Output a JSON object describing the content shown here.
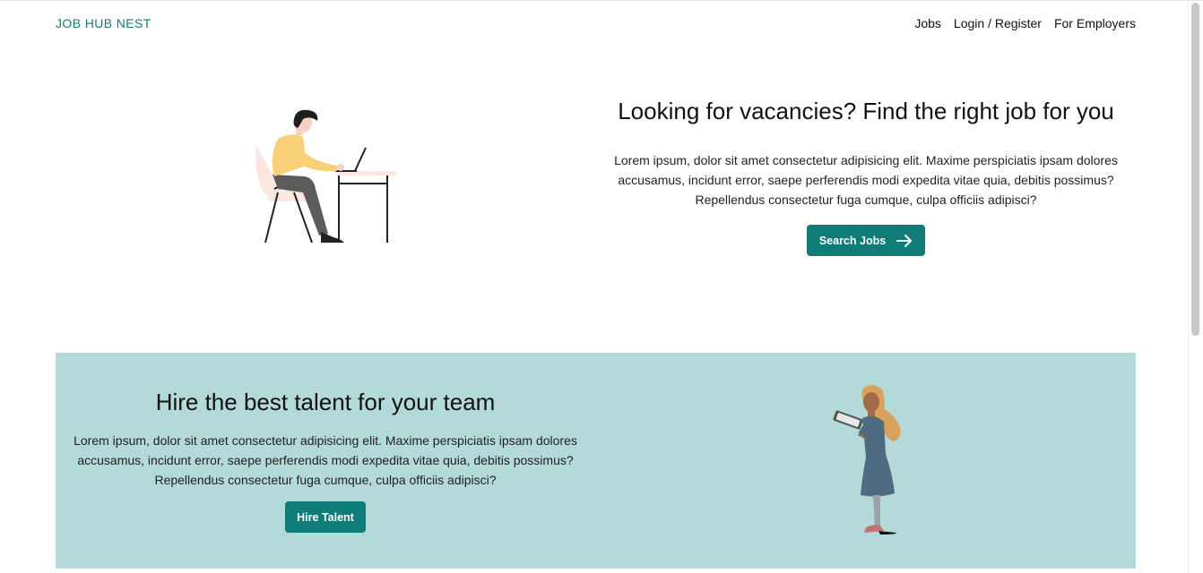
{
  "header": {
    "brand": "JOB HUB NEST",
    "nav": [
      "Jobs",
      "Login / Register",
      "For Employers"
    ]
  },
  "hero": {
    "title": "Looking for vacancies? Find the right job for you",
    "description": "Lorem ipsum, dolor sit amet consectetur adipisicing elit. Maxime perspiciatis ipsam dolores accusamus, incidunt error, saepe perferendis modi expedita vitae quia, debitis possimus? Repellendus consectetur fuga cumque, culpa officiis adipisci?",
    "button_label": "Search Jobs",
    "button_icon": "arrow-right-icon"
  },
  "hire": {
    "title": "Hire the best talent for your team",
    "description": "Lorem ipsum, dolor sit amet consectetur adipisicing elit. Maxime perspiciatis ipsam dolores accusamus, incidunt error, saepe perferendis modi expedita vitae quia, debitis possimus? Repellendus consectetur fuga cumque, culpa officiis adipisci?",
    "button_label": "Hire Talent"
  },
  "colors": {
    "brand": "#1a7a72",
    "button": "#0f7c78",
    "panel": "#b3d9d8"
  }
}
